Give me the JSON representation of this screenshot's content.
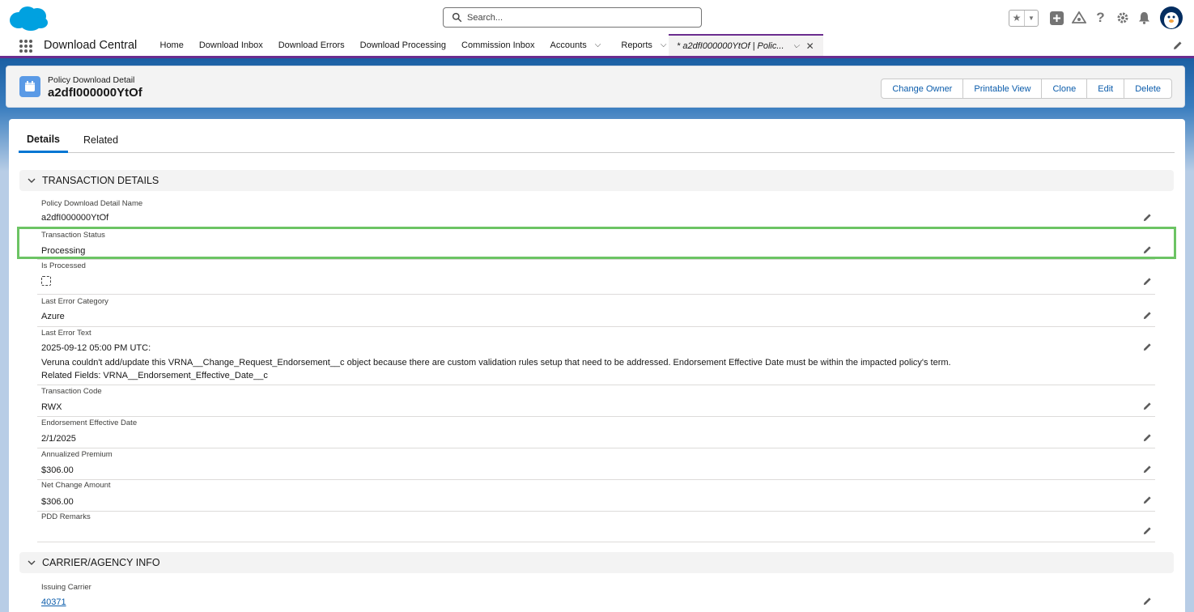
{
  "header": {
    "search_placeholder": "Search..."
  },
  "nav": {
    "app_name": "Download Central",
    "items": [
      {
        "label": "Home"
      },
      {
        "label": "Download Inbox"
      },
      {
        "label": "Download Errors"
      },
      {
        "label": "Download Processing"
      },
      {
        "label": "Commission Inbox"
      },
      {
        "label": "Accounts"
      },
      {
        "label": "Reports"
      }
    ],
    "active_tab": "* a2dfI000000YtOf | Polic..."
  },
  "record": {
    "type": "Policy Download Detail",
    "title": "a2dfI000000YtOf",
    "buttons": {
      "change_owner": "Change Owner",
      "printable_view": "Printable View",
      "clone": "Clone",
      "edit": "Edit",
      "delete": "Delete"
    }
  },
  "tabs": {
    "details": "Details",
    "related": "Related"
  },
  "sections": {
    "transaction": "TRANSACTION DETAILS",
    "carrier": "CARRIER/AGENCY INFO"
  },
  "fields": {
    "pdd_name": {
      "label": "Policy Download Detail Name",
      "value": "a2dfI000000YtOf"
    },
    "transaction_status": {
      "label": "Transaction Status",
      "value": "Processing"
    },
    "is_processed": {
      "label": "Is Processed"
    },
    "last_error_category": {
      "label": "Last Error Category",
      "value": "Azure"
    },
    "last_error_text": {
      "label": "Last Error Text",
      "line1": "2025-09-12 05:00 PM UTC:",
      "line2": "Veruna couldn't add/update this VRNA__Change_Request_Endorsement__c object because there are custom validation rules setup that need to be addressed. Endorsement Effective Date must be within the impacted policy's term.",
      "line3": "Related Fields: VRNA__Endorsement_Effective_Date__c"
    },
    "transaction_code": {
      "label": "Transaction Code",
      "value": "RWX"
    },
    "endorsement_effective_date": {
      "label": "Endorsement Effective Date",
      "value": "2/1/2025"
    },
    "annualized_premium": {
      "label": "Annualized Premium",
      "value": "$306.00"
    },
    "net_change_amount": {
      "label": "Net Change Amount",
      "value": "$306.00"
    },
    "pdd_remarks": {
      "label": "PDD Remarks",
      "value": ""
    },
    "issuing_carrier": {
      "label": "Issuing Carrier",
      "value": "40371"
    }
  },
  "colors": {
    "brand_blue": "#0176d3",
    "link": "#0b5cab",
    "highlight": "#6cc464",
    "nav_accent": "#6b2d8f"
  }
}
